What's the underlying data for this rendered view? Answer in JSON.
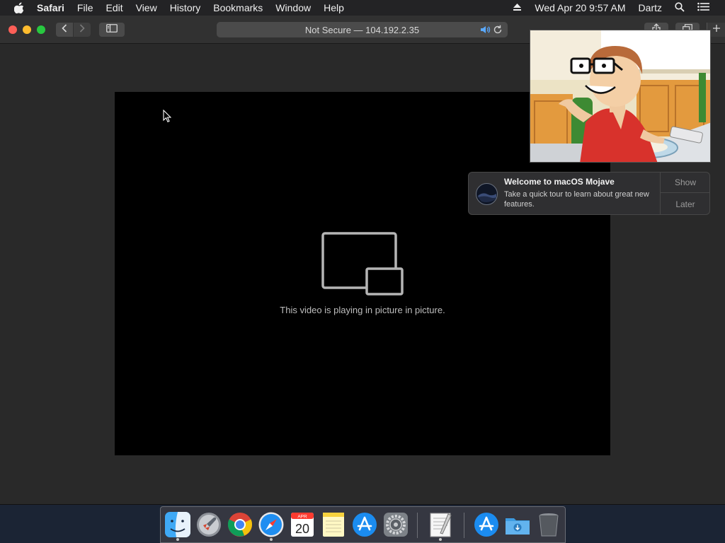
{
  "menubar": {
    "app_name": "Safari",
    "items": [
      "File",
      "Edit",
      "View",
      "History",
      "Bookmarks",
      "Window",
      "Help"
    ],
    "clock": "Wed Apr 20  9:57 AM",
    "user": "Dartz"
  },
  "browser": {
    "address_text": "Not Secure — 104.192.2.35"
  },
  "video": {
    "pip_message": "This video is playing in picture in picture."
  },
  "notification": {
    "title": "Welcome to macOS Mojave",
    "body": "Take a quick tour to learn about great new features.",
    "show_label": "Show",
    "later_label": "Later"
  },
  "dock": {
    "calendar_month": "APR",
    "calendar_day": "20",
    "items": [
      "finder-icon",
      "launchpad-icon",
      "chrome-icon",
      "safari-icon",
      "calendar-icon",
      "notes-icon",
      "app-store-icon",
      "system-preferences-icon",
      "textedit-icon",
      "applications-folder-icon",
      "downloads-folder-icon",
      "trash-icon"
    ]
  },
  "colors": {
    "close": "#fd5f57",
    "minimize": "#febc2e",
    "maximize": "#28c840",
    "speaker": "#5aa9ff"
  }
}
